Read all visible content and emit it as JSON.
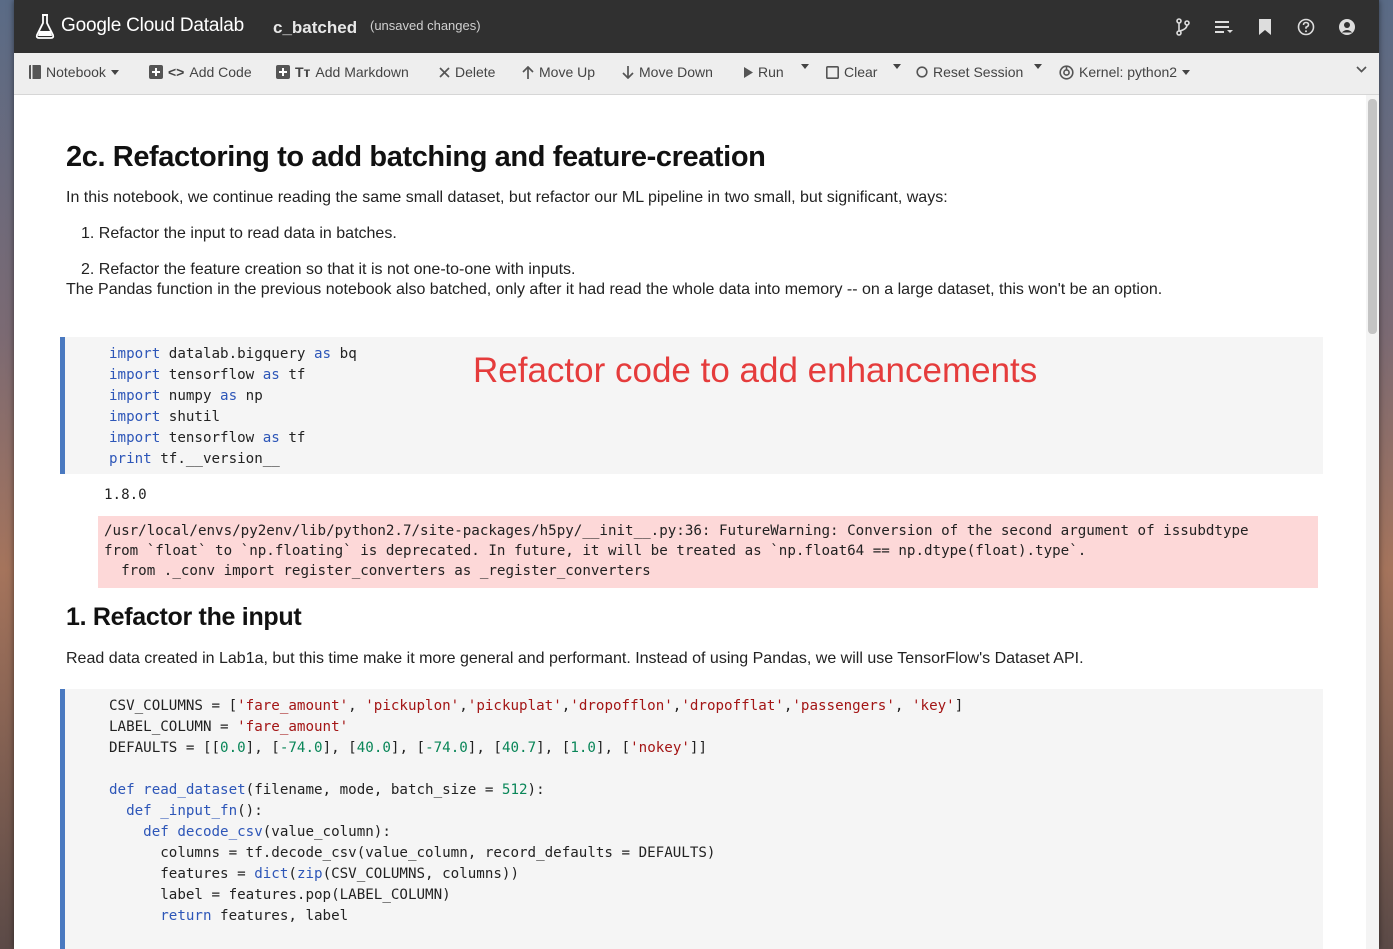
{
  "app": {
    "logo_text": "Google Cloud Datalab",
    "notebook_name": "c_batched",
    "save_status": "(unsaved changes)"
  },
  "toolbar": {
    "notebook": "Notebook",
    "add_code": "Add Code",
    "add_markdown": "Add Markdown",
    "delete": "Delete",
    "move_up": "Move Up",
    "move_down": "Move Down",
    "run": "Run",
    "clear": "Clear",
    "reset_session": "Reset Session",
    "kernel": "Kernel: python2"
  },
  "notebook": {
    "title": "2c. Refactoring to add batching and feature-creation",
    "intro": "In this notebook, we continue reading the same small dataset, but refactor our ML pipeline in two small, but significant, ways:",
    "list": [
      "1. Refactor the input to read data in batches.",
      "2. Refactor the feature creation so that it is not one-to-one with inputs."
    ],
    "note": "The Pandas function in the previous notebook also batched, only after it had read the whole data into memory -- on a large dataset, this won't be an option.",
    "annotation": "Refactor code to add enhancements",
    "cell1_lines": [
      "import datalab.bigquery as bq",
      "import tensorflow as tf",
      "import numpy as np",
      "import shutil",
      "import tensorflow as tf",
      "print tf.__version__"
    ],
    "output_version": "1.8.0",
    "warning_lines": [
      "/usr/local/envs/py2env/lib/python2.7/site-packages/h5py/__init__.py:36: FutureWarning: Conversion of the second argument of issubdtype",
      "from `float` to `np.floating` is deprecated. In future, it will be treated as `np.float64 == np.dtype(float).type`.",
      "  from ._conv import register_converters as _register_converters"
    ],
    "section_title": "1. Refactor the input",
    "section_text": "Read data created in Lab1a, but this time make it more general and performant. Instead of using Pandas, we will use TensorFlow's Dataset API.",
    "cell2_lines": [
      "CSV_COLUMNS = ['fare_amount', 'pickuplon','pickuplat','dropofflon','dropofflat','passengers', 'key']",
      "LABEL_COLUMN = 'fare_amount'",
      "DEFAULTS = [[0.0], [-74.0], [40.0], [-74.0], [40.7], [1.0], ['nokey']]",
      "",
      "def read_dataset(filename, mode, batch_size = 512):",
      "  def _input_fn():",
      "    def decode_csv(value_column):",
      "      columns = tf.decode_csv(value_column, record_defaults = DEFAULTS)",
      "      features = dict(zip(CSV_COLUMNS, columns))",
      "      label = features.pop(LABEL_COLUMN)",
      "      return features, label"
    ]
  },
  "icons": [
    "datalab-flask-icon",
    "git-branch-icon",
    "list-icon",
    "bookmark-icon",
    "help-icon",
    "account-icon"
  ],
  "colors": {
    "accent": "#4a79c0",
    "warning_bg": "#fdd8d8",
    "annotation": "#e53c3c",
    "topbar": "#303030"
  }
}
